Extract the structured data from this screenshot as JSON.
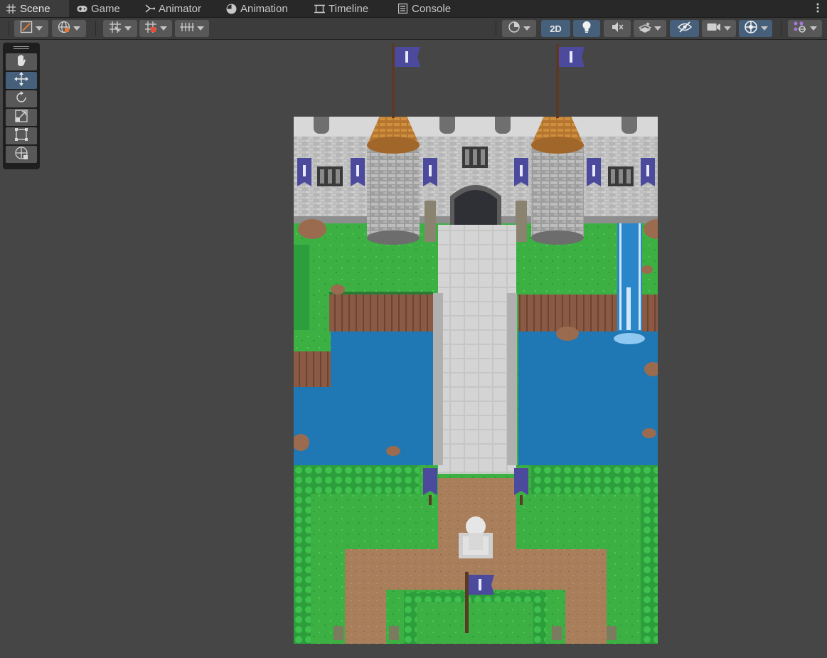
{
  "tabs": [
    {
      "label": "Scene",
      "icon": "scene-grid-icon",
      "active": true
    },
    {
      "label": "Game",
      "icon": "gamepad-icon",
      "active": false
    },
    {
      "label": "Animator",
      "icon": "animator-icon",
      "active": false
    },
    {
      "label": "Animation",
      "icon": "animation-clock-icon",
      "active": false
    },
    {
      "label": "Timeline",
      "icon": "timeline-icon",
      "active": false
    },
    {
      "label": "Console",
      "icon": "console-icon",
      "active": false
    }
  ],
  "toolbar": {
    "toggle_2d_label": "2D",
    "left_tools": [
      "draw-mode-icon",
      "global-icon",
      "grid-snap-icon",
      "increment-snap-icon",
      "align-icon"
    ],
    "right_tools": [
      "render-mode-icon",
      "lighting-icon",
      "audio-icon",
      "effects-icon",
      "visibility-icon",
      "camera-icon",
      "gizmo-orientation-icon",
      "gizmos-icon"
    ]
  },
  "palette": {
    "tools": [
      {
        "name": "hand-tool",
        "active": false
      },
      {
        "name": "move-tool",
        "active": true
      },
      {
        "name": "rotate-tool",
        "active": false
      },
      {
        "name": "scale-tool",
        "active": false
      },
      {
        "name": "rect-tool",
        "active": false
      },
      {
        "name": "transform-tool",
        "active": false
      }
    ]
  },
  "colors": {
    "accent": "#46607c",
    "grass": "#3cb043",
    "water": "#1f77b4",
    "stone": "#c8c8c8",
    "flag": "#4c4a9c",
    "roof": "#b4752e"
  }
}
